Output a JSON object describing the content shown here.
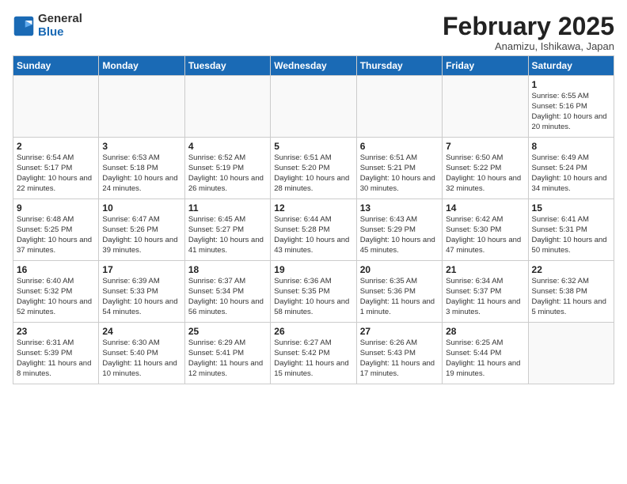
{
  "logo": {
    "general": "General",
    "blue": "Blue"
  },
  "title": "February 2025",
  "subtitle": "Anamizu, Ishikawa, Japan",
  "weekdays": [
    "Sunday",
    "Monday",
    "Tuesday",
    "Wednesday",
    "Thursday",
    "Friday",
    "Saturday"
  ],
  "weeks": [
    [
      {
        "day": "",
        "text": ""
      },
      {
        "day": "",
        "text": ""
      },
      {
        "day": "",
        "text": ""
      },
      {
        "day": "",
        "text": ""
      },
      {
        "day": "",
        "text": ""
      },
      {
        "day": "",
        "text": ""
      },
      {
        "day": "1",
        "text": "Sunrise: 6:55 AM\nSunset: 5:16 PM\nDaylight: 10 hours and 20 minutes."
      }
    ],
    [
      {
        "day": "2",
        "text": "Sunrise: 6:54 AM\nSunset: 5:17 PM\nDaylight: 10 hours and 22 minutes."
      },
      {
        "day": "3",
        "text": "Sunrise: 6:53 AM\nSunset: 5:18 PM\nDaylight: 10 hours and 24 minutes."
      },
      {
        "day": "4",
        "text": "Sunrise: 6:52 AM\nSunset: 5:19 PM\nDaylight: 10 hours and 26 minutes."
      },
      {
        "day": "5",
        "text": "Sunrise: 6:51 AM\nSunset: 5:20 PM\nDaylight: 10 hours and 28 minutes."
      },
      {
        "day": "6",
        "text": "Sunrise: 6:51 AM\nSunset: 5:21 PM\nDaylight: 10 hours and 30 minutes."
      },
      {
        "day": "7",
        "text": "Sunrise: 6:50 AM\nSunset: 5:22 PM\nDaylight: 10 hours and 32 minutes."
      },
      {
        "day": "8",
        "text": "Sunrise: 6:49 AM\nSunset: 5:24 PM\nDaylight: 10 hours and 34 minutes."
      }
    ],
    [
      {
        "day": "9",
        "text": "Sunrise: 6:48 AM\nSunset: 5:25 PM\nDaylight: 10 hours and 37 minutes."
      },
      {
        "day": "10",
        "text": "Sunrise: 6:47 AM\nSunset: 5:26 PM\nDaylight: 10 hours and 39 minutes."
      },
      {
        "day": "11",
        "text": "Sunrise: 6:45 AM\nSunset: 5:27 PM\nDaylight: 10 hours and 41 minutes."
      },
      {
        "day": "12",
        "text": "Sunrise: 6:44 AM\nSunset: 5:28 PM\nDaylight: 10 hours and 43 minutes."
      },
      {
        "day": "13",
        "text": "Sunrise: 6:43 AM\nSunset: 5:29 PM\nDaylight: 10 hours and 45 minutes."
      },
      {
        "day": "14",
        "text": "Sunrise: 6:42 AM\nSunset: 5:30 PM\nDaylight: 10 hours and 47 minutes."
      },
      {
        "day": "15",
        "text": "Sunrise: 6:41 AM\nSunset: 5:31 PM\nDaylight: 10 hours and 50 minutes."
      }
    ],
    [
      {
        "day": "16",
        "text": "Sunrise: 6:40 AM\nSunset: 5:32 PM\nDaylight: 10 hours and 52 minutes."
      },
      {
        "day": "17",
        "text": "Sunrise: 6:39 AM\nSunset: 5:33 PM\nDaylight: 10 hours and 54 minutes."
      },
      {
        "day": "18",
        "text": "Sunrise: 6:37 AM\nSunset: 5:34 PM\nDaylight: 10 hours and 56 minutes."
      },
      {
        "day": "19",
        "text": "Sunrise: 6:36 AM\nSunset: 5:35 PM\nDaylight: 10 hours and 58 minutes."
      },
      {
        "day": "20",
        "text": "Sunrise: 6:35 AM\nSunset: 5:36 PM\nDaylight: 11 hours and 1 minute."
      },
      {
        "day": "21",
        "text": "Sunrise: 6:34 AM\nSunset: 5:37 PM\nDaylight: 11 hours and 3 minutes."
      },
      {
        "day": "22",
        "text": "Sunrise: 6:32 AM\nSunset: 5:38 PM\nDaylight: 11 hours and 5 minutes."
      }
    ],
    [
      {
        "day": "23",
        "text": "Sunrise: 6:31 AM\nSunset: 5:39 PM\nDaylight: 11 hours and 8 minutes."
      },
      {
        "day": "24",
        "text": "Sunrise: 6:30 AM\nSunset: 5:40 PM\nDaylight: 11 hours and 10 minutes."
      },
      {
        "day": "25",
        "text": "Sunrise: 6:29 AM\nSunset: 5:41 PM\nDaylight: 11 hours and 12 minutes."
      },
      {
        "day": "26",
        "text": "Sunrise: 6:27 AM\nSunset: 5:42 PM\nDaylight: 11 hours and 15 minutes."
      },
      {
        "day": "27",
        "text": "Sunrise: 6:26 AM\nSunset: 5:43 PM\nDaylight: 11 hours and 17 minutes."
      },
      {
        "day": "28",
        "text": "Sunrise: 6:25 AM\nSunset: 5:44 PM\nDaylight: 11 hours and 19 minutes."
      },
      {
        "day": "",
        "text": ""
      }
    ]
  ]
}
